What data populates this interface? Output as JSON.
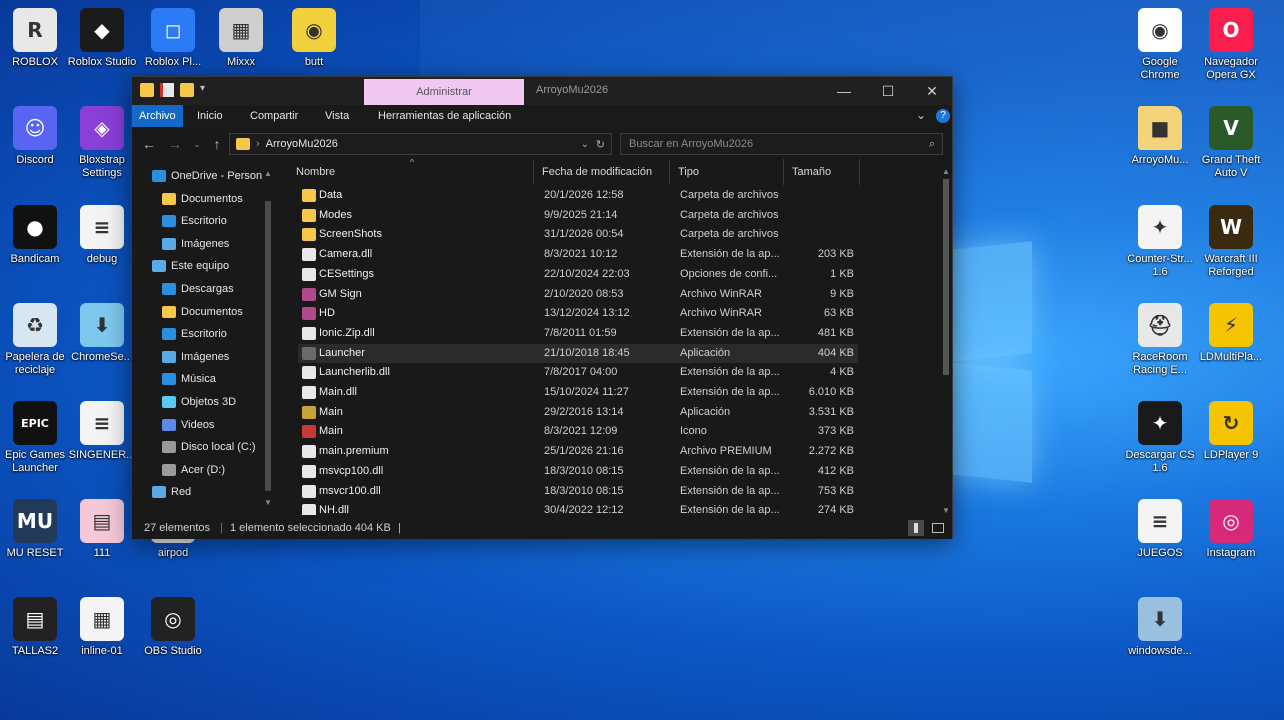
{
  "desktop": {
    "icons_left": [
      {
        "id": "roblox",
        "label": "ROBLOX",
        "icon": "roblox-icon",
        "color": "#e8e8e8"
      },
      {
        "id": "roblox-studio",
        "label": "Roblox Studio",
        "icon": "roblox-studio-icon",
        "color": "#1b1b1b"
      },
      {
        "id": "roblox-player",
        "label": "Roblox Pl...",
        "icon": "roblox-player-icon",
        "color": "#2a7bf5"
      },
      {
        "id": "mixxx",
        "label": "Mixxx",
        "icon": "mixxx-icon",
        "color": "#cfcfcf"
      },
      {
        "id": "butt",
        "label": "butt",
        "icon": "speaker-icon",
        "color": "#f2d23c"
      },
      {
        "id": "discord",
        "label": "Discord",
        "icon": "discord-icon",
        "color": "#5865f2"
      },
      {
        "id": "bloxstrap",
        "label": "Bloxstrap Settings",
        "icon": "bloxstrap-icon",
        "color": "#8a3fd8"
      },
      {
        "id": "bandicam",
        "label": "Bandicam",
        "icon": "bandicam-icon",
        "color": "#111111"
      },
      {
        "id": "debug",
        "label": "debug",
        "icon": "document-icon",
        "color": "#f4f4f4"
      },
      {
        "id": "recycle-bin",
        "label": "Papelera de reciclaje",
        "icon": "recycle-bin-icon",
        "color": "#d8e6f2"
      },
      {
        "id": "chromesetup",
        "label": "ChromeSe...",
        "icon": "installer-icon",
        "color": "#7ec8f0"
      },
      {
        "id": "epic",
        "label": "Epic Games Launcher",
        "icon": "epic-games-icon",
        "color": "#111111"
      },
      {
        "id": "singener",
        "label": "SINGENER...",
        "icon": "document-icon",
        "color": "#f4f4f4"
      },
      {
        "id": "mu-reset",
        "label": "MU RESET",
        "icon": "mu-reset-icon",
        "color": "#23395a"
      },
      {
        "id": "111",
        "label": "111",
        "icon": "image-file-icon",
        "color": "#f4c8d8"
      },
      {
        "id": "airpod",
        "label": "airpod",
        "icon": "image-file-icon",
        "color": "#f4f4f4"
      },
      {
        "id": "tallas2",
        "label": "TALLAS2",
        "icon": "image-file-icon",
        "color": "#222222"
      },
      {
        "id": "inline-01",
        "label": "inline-01",
        "icon": "spreadsheet-icon",
        "color": "#f4f4f4"
      },
      {
        "id": "obs",
        "label": "OBS Studio",
        "icon": "obs-icon",
        "color": "#222222"
      }
    ],
    "icons_right": [
      {
        "id": "chrome",
        "label": "Google Chrome",
        "icon": "chrome-icon",
        "color": "#ffffff"
      },
      {
        "id": "opera-gx",
        "label": "Navegador Opera GX",
        "icon": "opera-gx-icon",
        "color": "#fa1e4e"
      },
      {
        "id": "arroyomu",
        "label": "ArroyoMu...",
        "icon": "folder-icon",
        "color": "#f5d37a"
      },
      {
        "id": "gta-v",
        "label": "Grand Theft Auto V",
        "icon": "gta-v-icon",
        "color": "#2a5a2a"
      },
      {
        "id": "cs16",
        "label": "Counter-Str... 1.6",
        "icon": "counter-strike-icon",
        "color": "#f4f4f4"
      },
      {
        "id": "warcraft",
        "label": "Warcraft III Reforged",
        "icon": "warcraft-icon",
        "color": "#3a2a10"
      },
      {
        "id": "raceroom",
        "label": "RaceRoom Racing E...",
        "icon": "raceroom-icon",
        "color": "#e8e8e8"
      },
      {
        "id": "ldmulti",
        "label": "LDMultiPla...",
        "icon": "ldmultiplayer-icon",
        "color": "#f5c400"
      },
      {
        "id": "descargar-cs",
        "label": "Descargar CS 1.6",
        "icon": "cs-download-icon",
        "color": "#1a1a1a"
      },
      {
        "id": "ldplayer",
        "label": "LDPlayer 9",
        "icon": "ldplayer-icon",
        "color": "#f5c400"
      },
      {
        "id": "juegos",
        "label": "JUEGOS",
        "icon": "document-icon",
        "color": "#f4f4f4"
      },
      {
        "id": "instagram",
        "label": "Instagram",
        "icon": "instagram-icon",
        "color": "#d6297a"
      },
      {
        "id": "windowsde",
        "label": "windowsde...",
        "icon": "installer-icon",
        "color": "#9ac0e0"
      }
    ]
  },
  "explorer": {
    "context_tab": "Administrar",
    "window_title": "ArroyoMu2026",
    "controls": {
      "minimize": "—",
      "maximize": "☐",
      "close": "✕"
    },
    "ribbon_tabs": [
      "Archivo",
      "Inicio",
      "Compartir",
      "Vista",
      "Herramientas de aplicación"
    ],
    "address_path": "ArroyoMu2026",
    "search_placeholder": "Buscar en ArroyoMu2026",
    "nav": [
      {
        "label": "OneDrive - Person",
        "icon": "onedrive-icon",
        "indent": 0
      },
      {
        "label": "Documentos",
        "icon": "folder-icon",
        "indent": 1
      },
      {
        "label": "Escritorio",
        "icon": "desktop-folder-icon",
        "indent": 1
      },
      {
        "label": "Imágenes",
        "icon": "pictures-folder-icon",
        "indent": 1
      },
      {
        "label": "Este equipo",
        "icon": "this-pc-icon",
        "indent": 0
      },
      {
        "label": "Descargas",
        "icon": "downloads-icon",
        "indent": 1
      },
      {
        "label": "Documentos",
        "icon": "folder-icon",
        "indent": 1
      },
      {
        "label": "Escritorio",
        "icon": "desktop-folder-icon",
        "indent": 1
      },
      {
        "label": "Imágenes",
        "icon": "pictures-folder-icon",
        "indent": 1
      },
      {
        "label": "Música",
        "icon": "music-icon",
        "indent": 1
      },
      {
        "label": "Objetos 3D",
        "icon": "3d-objects-icon",
        "indent": 1
      },
      {
        "label": "Videos",
        "icon": "videos-icon",
        "indent": 1
      },
      {
        "label": "Disco local (C:)",
        "icon": "drive-icon",
        "indent": 1
      },
      {
        "label": "Acer (D:)",
        "icon": "drive-icon",
        "indent": 1
      },
      {
        "label": "Red",
        "icon": "network-icon",
        "indent": 0
      }
    ],
    "columns": [
      "Nombre",
      "Fecha de modificación",
      "Tipo",
      "Tamaño"
    ],
    "files": [
      {
        "name": "Data",
        "date": "20/1/2026 12:58",
        "type": "Carpeta de archivos",
        "size": "",
        "icon": "folder-icon",
        "color": "#f5c84a"
      },
      {
        "name": "Modes",
        "date": "9/9/2025 21:14",
        "type": "Carpeta de archivos",
        "size": "",
        "icon": "folder-icon",
        "color": "#f5c84a"
      },
      {
        "name": "ScreenShots",
        "date": "31/1/2026 00:54",
        "type": "Carpeta de archivos",
        "size": "",
        "icon": "folder-icon",
        "color": "#f5c84a"
      },
      {
        "name": "Camera.dll",
        "date": "8/3/2021 10:12",
        "type": "Extensión de la ap...",
        "size": "203 KB",
        "icon": "dll-file-icon",
        "color": "#e8e8e8"
      },
      {
        "name": "CESettings",
        "date": "22/10/2024 22:03",
        "type": "Opciones de confi...",
        "size": "1 KB",
        "icon": "settings-file-icon",
        "color": "#e8e8e8"
      },
      {
        "name": "GM Sign",
        "date": "2/10/2020 08:53",
        "type": "Archivo WinRAR",
        "size": "9 KB",
        "icon": "winrar-icon",
        "color": "#b04a8a"
      },
      {
        "name": "HD",
        "date": "13/12/2024 13:12",
        "type": "Archivo WinRAR",
        "size": "63 KB",
        "icon": "winrar-icon",
        "color": "#b04a8a"
      },
      {
        "name": "Ionic.Zip.dll",
        "date": "7/8/2011 01:59",
        "type": "Extensión de la ap...",
        "size": "481 KB",
        "icon": "dll-file-icon",
        "color": "#e8e8e8"
      },
      {
        "name": "Launcher",
        "date": "21/10/2018 18:45",
        "type": "Aplicación",
        "size": "404 KB",
        "icon": "launcher-app-icon",
        "color": "#6a6a6a"
      },
      {
        "name": "Launcherlib.dll",
        "date": "7/8/2017 04:00",
        "type": "Extensión de la ap...",
        "size": "4 KB",
        "icon": "dll-file-icon",
        "color": "#e8e8e8"
      },
      {
        "name": "Main.dll",
        "date": "15/10/2024 11:27",
        "type": "Extensión de la ap...",
        "size": "6.010 KB",
        "icon": "dll-file-icon",
        "color": "#e8e8e8"
      },
      {
        "name": "Main",
        "date": "29/2/2016 13:14",
        "type": "Aplicación",
        "size": "3.531 KB",
        "icon": "mu-app-icon",
        "color": "#c8a23a"
      },
      {
        "name": "Main",
        "date": "8/3/2021 12:09",
        "type": "Icono",
        "size": "373 KB",
        "icon": "mu-ico-icon",
        "color": "#c83a3a"
      },
      {
        "name": "main.premium",
        "date": "25/1/2026 21:16",
        "type": "Archivo PREMIUM",
        "size": "2.272 KB",
        "icon": "generic-file-icon",
        "color": "#e8e8e8"
      },
      {
        "name": "msvcp100.dll",
        "date": "18/3/2010 08:15",
        "type": "Extensión de la ap...",
        "size": "412 KB",
        "icon": "dll-file-icon",
        "color": "#e8e8e8"
      },
      {
        "name": "msvcr100.dll",
        "date": "18/3/2010 08:15",
        "type": "Extensión de la ap...",
        "size": "753 KB",
        "icon": "dll-file-icon",
        "color": "#e8e8e8"
      },
      {
        "name": "NH.dll",
        "date": "30/4/2022 12:12",
        "type": "Extensión de la ap...",
        "size": "274 KB",
        "icon": "dll-file-icon",
        "color": "#e8e8e8"
      }
    ],
    "selected_file": "Launcher",
    "status": {
      "count": "27 elementos",
      "selection": "1 elemento seleccionado  404 KB"
    }
  },
  "colors": {
    "accent": "#1469c7",
    "context_tab": "#f0c8f2",
    "window_bg": "#191919"
  }
}
